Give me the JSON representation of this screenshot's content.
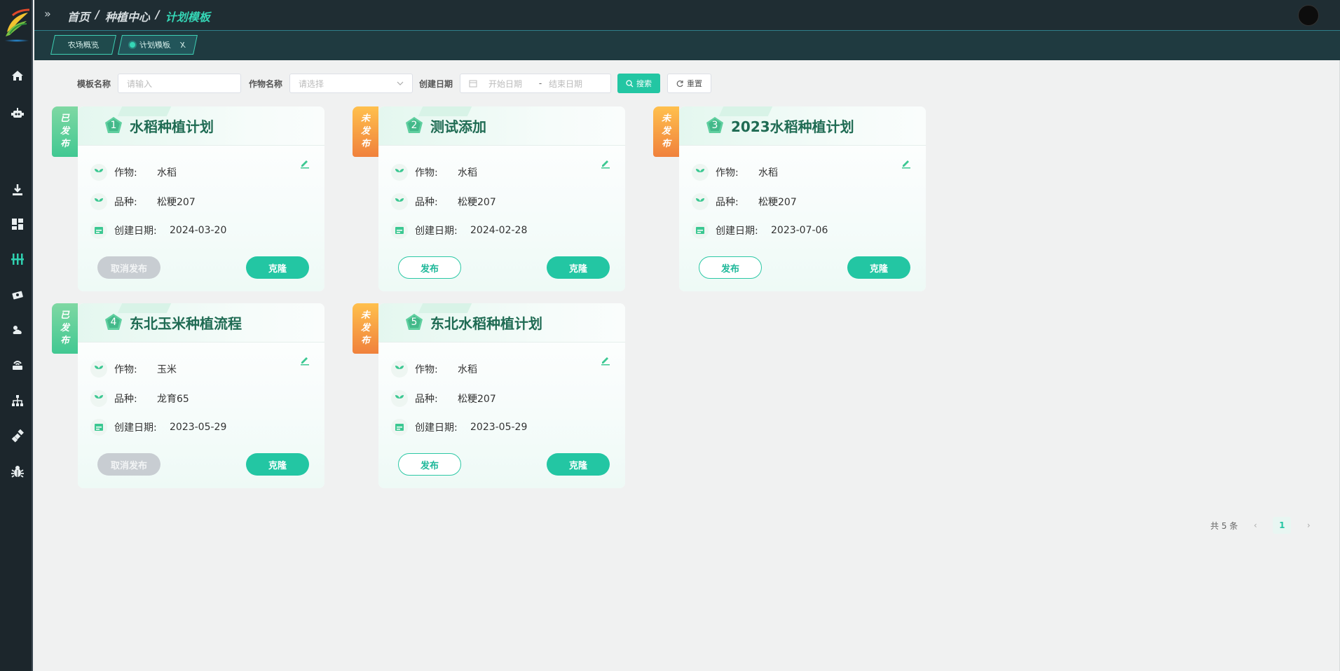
{
  "breadcrumb": {
    "items": [
      "首页",
      "种植中心"
    ],
    "current": "计划模板",
    "separator": "/"
  },
  "tabs": [
    {
      "label": "农场概览",
      "active": false
    },
    {
      "label": "计划模板",
      "active": true,
      "close": "X"
    }
  ],
  "search": {
    "template_name_label": "模板名称",
    "template_name_placeholder": "请输入",
    "crop_name_label": "作物名称",
    "crop_name_placeholder": "请选择",
    "create_date_label": "创建日期",
    "start_placeholder": "开始日期",
    "range_sep": "-",
    "end_placeholder": "结束日期",
    "search_button": "搜索",
    "reset_button": "重置"
  },
  "field_labels": {
    "crop": "作物:",
    "variety": "品种:",
    "created": "创建日期:"
  },
  "status_labels": {
    "published": [
      "已",
      "发",
      "布"
    ],
    "unpublished": [
      "未",
      "发",
      "布"
    ]
  },
  "cards": [
    {
      "index": "1",
      "title": "水稻种植计划",
      "status": "published",
      "crop": "水稻",
      "variety": "松粳207",
      "created": "2024-03-20",
      "left_button": "取消发布",
      "right_button": "克隆"
    },
    {
      "index": "2",
      "title": "测试添加",
      "status": "unpublished",
      "crop": "水稻",
      "variety": "松粳207",
      "created": "2024-02-28",
      "left_button": "发布",
      "right_button": "克隆"
    },
    {
      "index": "3",
      "title": "2023水稻种植计划",
      "status": "unpublished",
      "crop": "水稻",
      "variety": "松粳207",
      "created": "2023-07-06",
      "left_button": "发布",
      "right_button": "克隆"
    },
    {
      "index": "4",
      "title": "东北玉米种植流程",
      "status": "published",
      "crop": "玉米",
      "variety": "龙育65",
      "created": "2023-05-29",
      "left_button": "取消发布",
      "right_button": "克隆"
    },
    {
      "index": "5",
      "title": "东北水稻种植计划",
      "status": "unpublished",
      "crop": "水稻",
      "variety": "松粳207",
      "created": "2023-05-29",
      "left_button": "发布",
      "right_button": "克隆"
    }
  ],
  "pagination": {
    "total_text": "共 5 条",
    "current_page": "1",
    "prev": "‹",
    "next": "›"
  },
  "colors": {
    "accent": "#23c6a3",
    "published": "#41c892",
    "unpublished": "#f0813c",
    "sidebar": "#1c262c"
  }
}
